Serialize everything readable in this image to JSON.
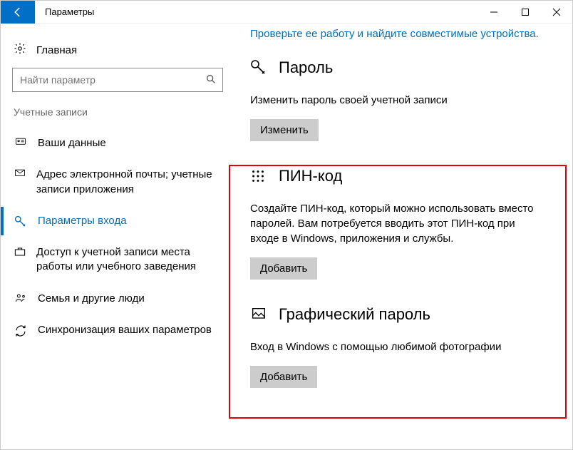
{
  "window": {
    "title": "Параметры"
  },
  "sidebar": {
    "home_label": "Главная",
    "search_placeholder": "Найти параметр",
    "section_header": "Учетные записи",
    "items": [
      {
        "label": "Ваши данные"
      },
      {
        "label": "Адрес электронной почты; учетные записи приложения"
      },
      {
        "label": "Параметры входа"
      },
      {
        "label": "Доступ к учетной записи места работы или учебного заведения"
      },
      {
        "label": "Семья и другие люди"
      },
      {
        "label": "Синхронизация ваших параметров"
      }
    ]
  },
  "content": {
    "hello_link": "Проверьте ее работу и найдите совместимые устройства.",
    "password": {
      "title": "Пароль",
      "desc": "Изменить пароль своей учетной записи",
      "button": "Изменить"
    },
    "pin": {
      "title": "ПИН-код",
      "desc": "Создайте ПИН-код, который можно использовать вместо паролей. Вам потребуется вводить этот ПИН-код при входе в Windows, приложения и службы.",
      "button": "Добавить"
    },
    "picture": {
      "title": "Графический пароль",
      "desc": "Вход в Windows с помощью любимой фотографии",
      "button": "Добавить"
    }
  }
}
